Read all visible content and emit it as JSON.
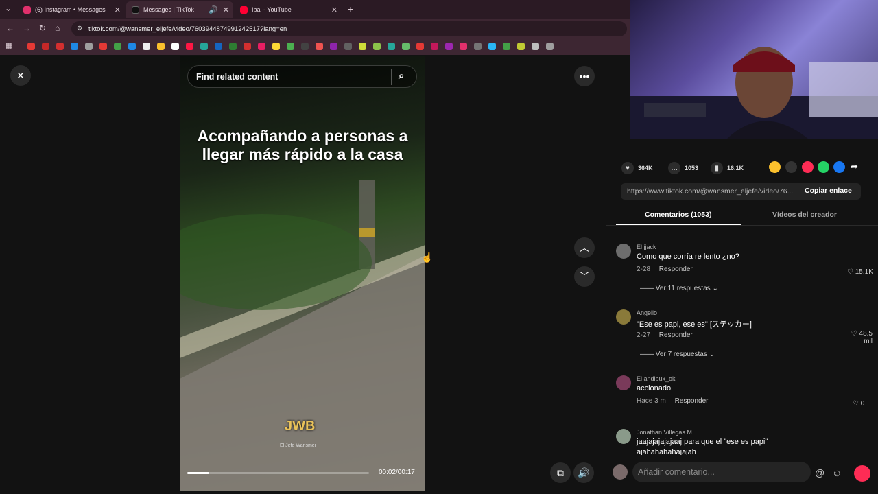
{
  "browser": {
    "tabs": [
      {
        "label": "(6) Instagram • Messages",
        "color": "#e1306c"
      },
      {
        "label": "Messages | TikTok",
        "color": "#111111"
      },
      {
        "label": "Ibai - YouTube",
        "color": "#ff0033"
      }
    ],
    "new_tab_label": "+",
    "url": "tiktok.com/@wansmer_eljefe/video/7603944874991242517?lang=en"
  },
  "video": {
    "search_placeholder": "Find related content",
    "caption": "Acompañando a personas a llegar más rápido a la casa",
    "watermark": "JWB",
    "watermark_sub": "El Jefe Wansmer",
    "time": "00:02/00:17",
    "progress": 0.12
  },
  "panel": {
    "stats": {
      "likes": "364K",
      "comments": "1053",
      "saves": "16.1K"
    },
    "link": "https://www.tiktok.com/@wansmer_eljefe/video/76...",
    "copy_label": "Copiar enlace",
    "tab_comments": "Comentarios (1053)",
    "tab_videos": "Vídeos del creador",
    "reply_label": "Responder",
    "comments": [
      {
        "user": "El jjack",
        "text": "Como que corría re lento ¿no?",
        "date": "2-28",
        "likes": "15.1K",
        "more": "Ver 11 respuestas"
      },
      {
        "user": "Angello",
        "text": "\"Ese es papi, ese es\" [ステッカー]",
        "date": "2-27",
        "likes": "48.5 mil",
        "more": "Ver 7 respuestas"
      },
      {
        "user": "El andibux_ok",
        "text": "accionado",
        "date": "Hace 3 m",
        "likes": "0"
      },
      {
        "user": "Jonathan Villegas M.",
        "text": "jaajajajajajaaj para que el \"ese es papi\"",
        "text2": "ajahahahahajajah"
      }
    ],
    "add_comment_placeholder": "Añadir comentario..."
  }
}
